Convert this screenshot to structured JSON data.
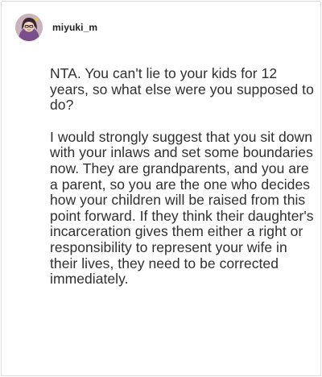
{
  "post": {
    "username": "miyuki_m",
    "avatar_icon": "avatar-icon",
    "paragraphs": [
      "NTA. You can't lie to your kids for 12 years, so what else were you supposed to do?",
      "I would strongly suggest that you sit down with your inlaws and set some boundaries now. They are grandparents, and you are a parent, so you are the one who decides how your children will be raised from this point forward. If they think their daughter's incarceration gives them either a right or responsibility to represent your wife in their lives, they need to be corrected immediately."
    ]
  }
}
